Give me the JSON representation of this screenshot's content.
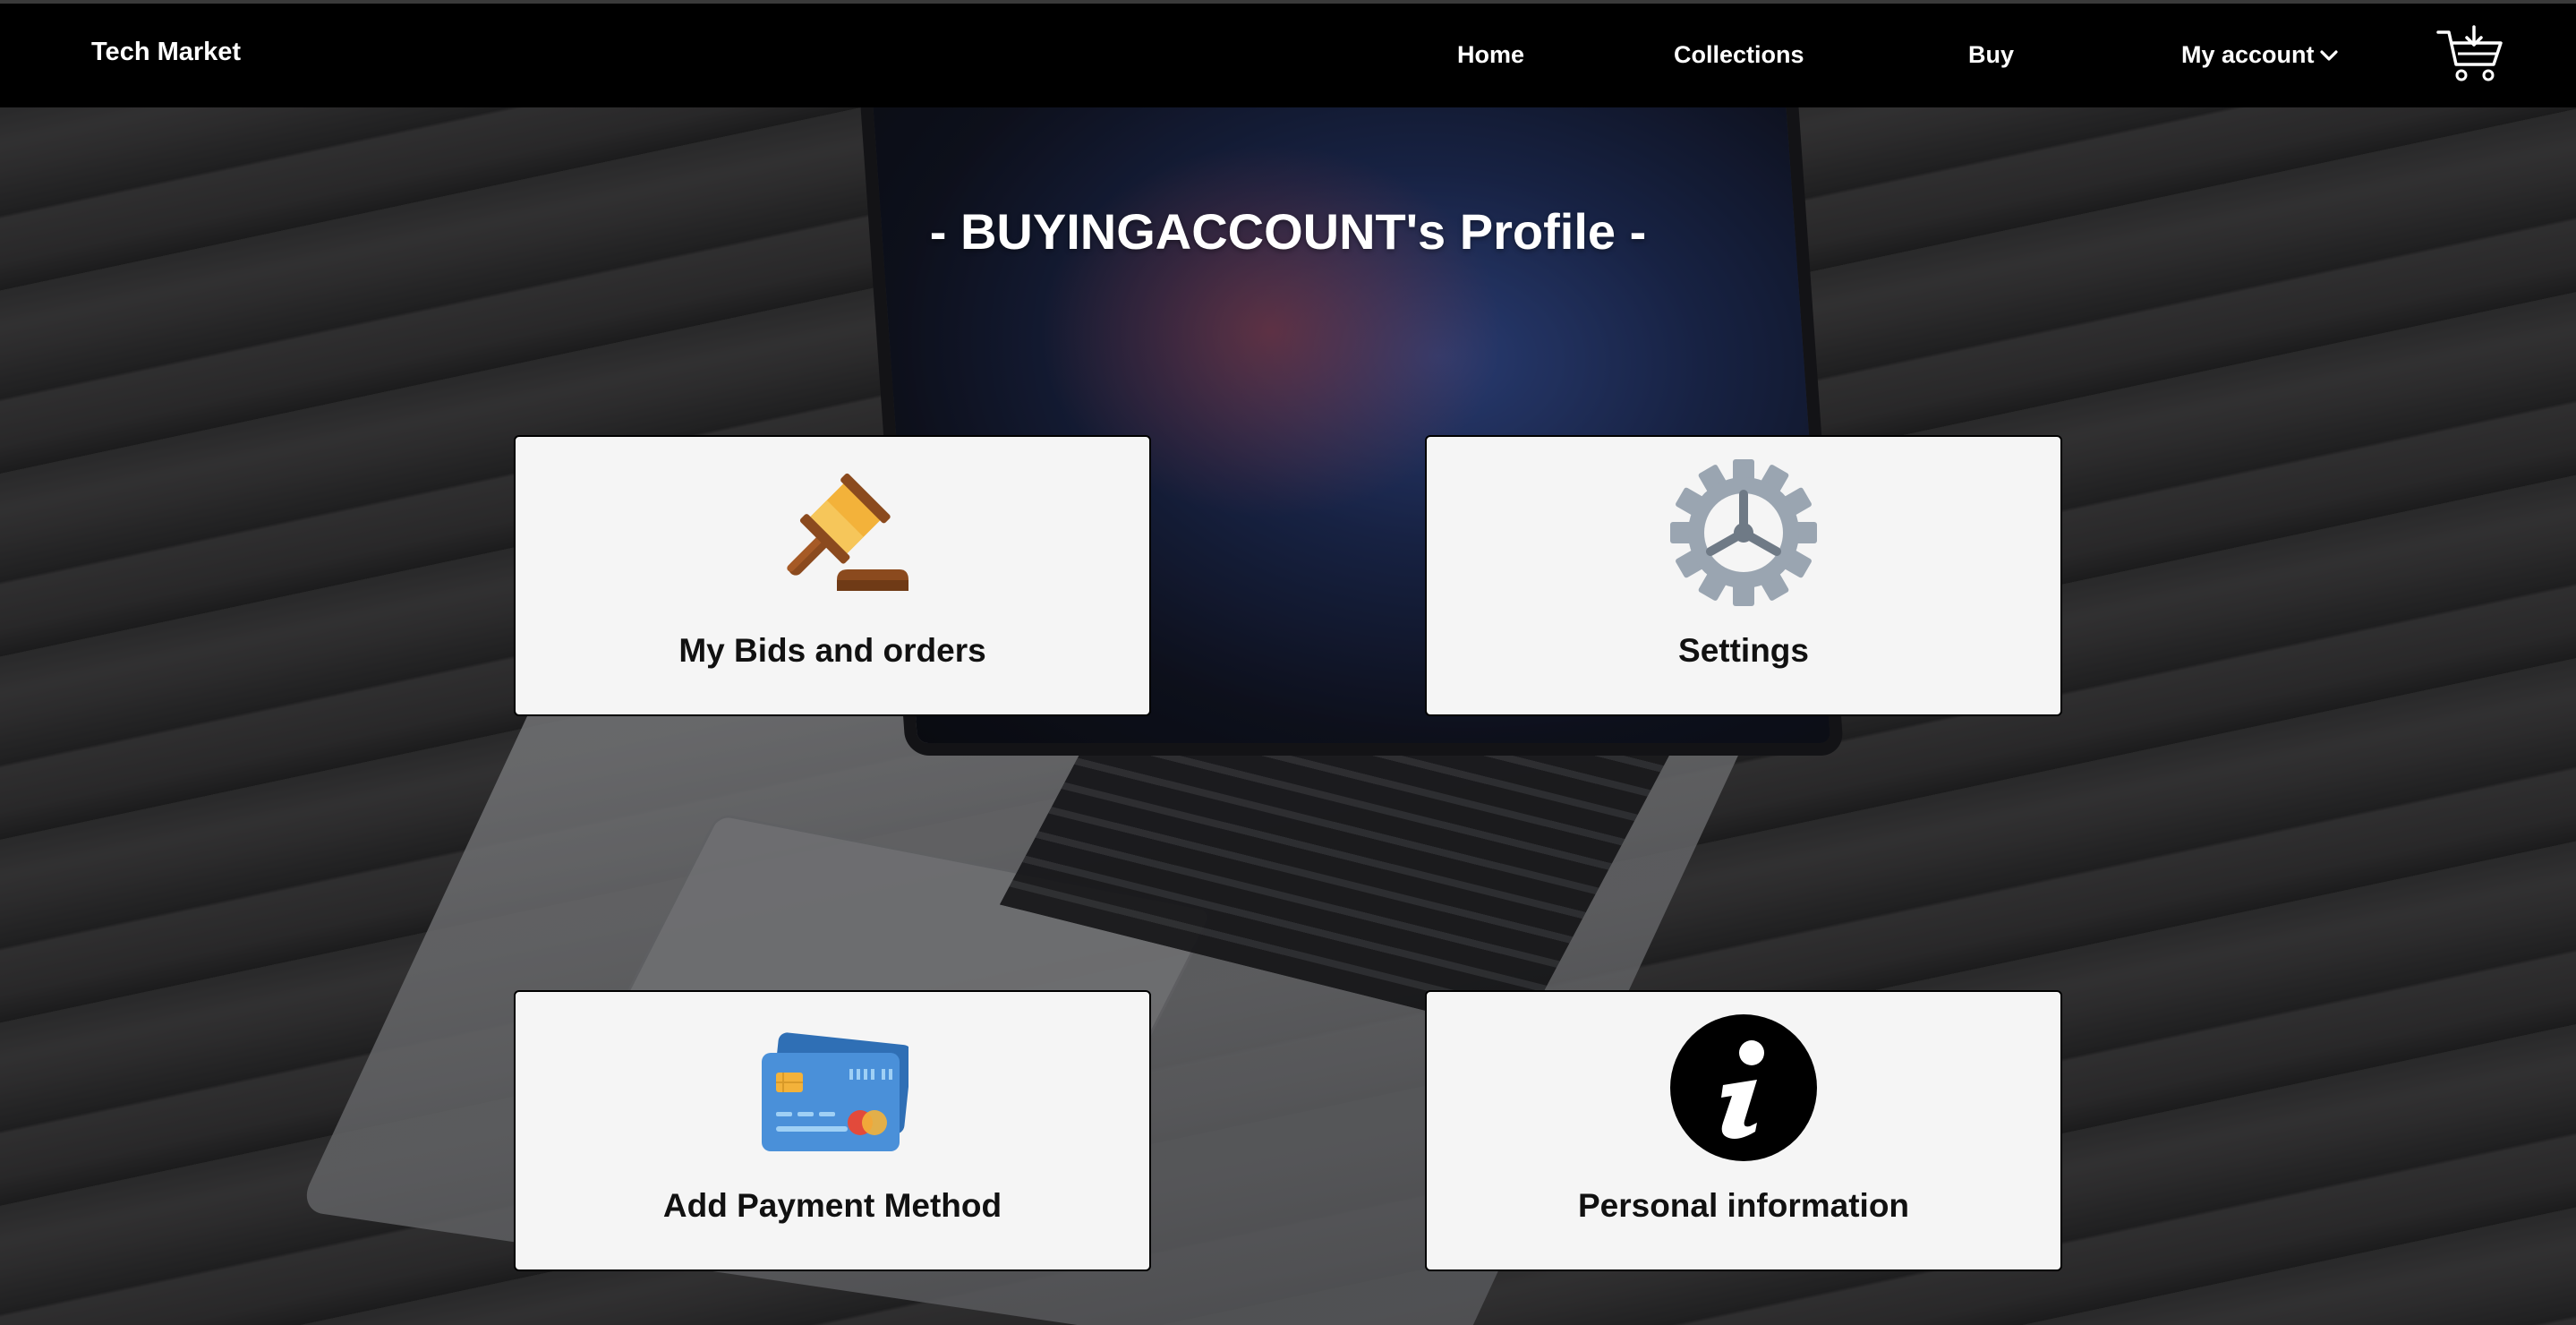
{
  "brand": "Tech Market",
  "nav": {
    "home": "Home",
    "collections": "Collections",
    "buy": "Buy",
    "account": "My account"
  },
  "icons": {
    "account_dropdown": "chevron-down-icon",
    "cart": "cart-icon"
  },
  "profile_title": "- BUYINGACCOUNT's Profile -",
  "cards": {
    "bids": {
      "label": "My Bids and orders",
      "icon": "gavel-icon"
    },
    "settings": {
      "label": "Settings",
      "icon": "gear-icon"
    },
    "payment": {
      "label": "Add Payment Method",
      "icon": "credit-card-icon"
    },
    "info": {
      "label": "Personal information",
      "icon": "info-icon"
    }
  },
  "colors": {
    "navbar": "#000000",
    "card_bg": "#f5f5f5",
    "gear": "#9aa5b1",
    "gavel_head": "#f3b23a",
    "gavel_wood": "#8b4a1e",
    "card_blue": "#4a90d9"
  }
}
